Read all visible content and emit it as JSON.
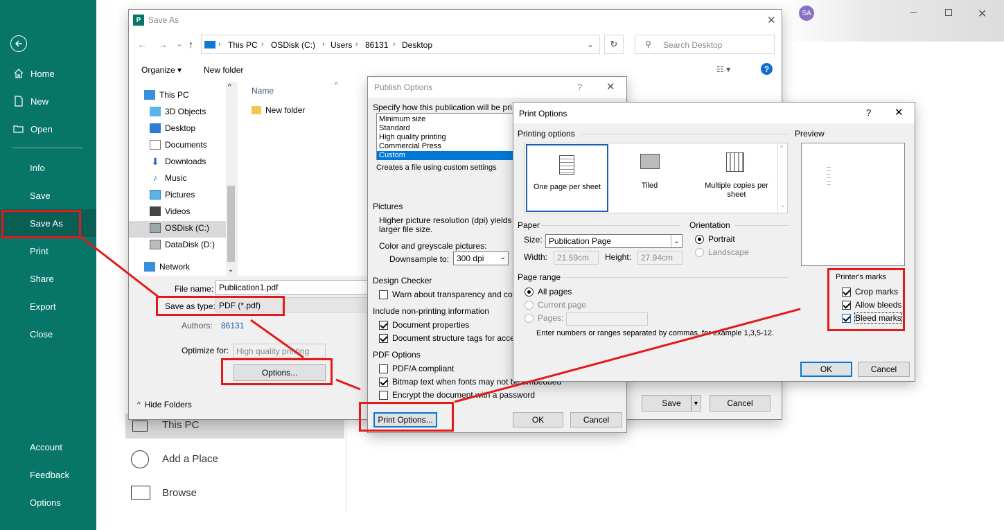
{
  "sidebar": {
    "items": [
      {
        "label": "Home"
      },
      {
        "label": "New"
      },
      {
        "label": "Open"
      },
      {
        "label": "Info"
      },
      {
        "label": "Save"
      },
      {
        "label": "Save As"
      },
      {
        "label": "Print"
      },
      {
        "label": "Share"
      },
      {
        "label": "Export"
      },
      {
        "label": "Close"
      },
      {
        "label": "Account"
      },
      {
        "label": "Feedback"
      },
      {
        "label": "Options"
      }
    ]
  },
  "header": {
    "avatar": "SA"
  },
  "places": {
    "this_pc": "This PC",
    "add_place": "Add a Place",
    "browse": "Browse"
  },
  "save_as_dialog": {
    "title": "Save As",
    "breadcrumb": [
      "This PC",
      "OSDisk (C:)",
      "Users",
      "86131",
      "Desktop"
    ],
    "search_placeholder": "Search Desktop",
    "organize": "Organize",
    "new_folder": "New folder",
    "tree": [
      "This PC",
      "3D Objects",
      "Desktop",
      "Documents",
      "Downloads",
      "Music",
      "Pictures",
      "Videos",
      "OSDisk (C:)",
      "DataDisk (D:)",
      "Network"
    ],
    "column_name": "Name",
    "files": [
      "New folder"
    ],
    "file_name_label": "File name:",
    "file_name": "Publication1.pdf",
    "save_type_label": "Save as type:",
    "save_type": "PDF (*.pdf)",
    "authors_label": "Authors:",
    "authors": "86131",
    "optimize_label": "Optimize for:",
    "optimize_value": "High quality printing",
    "options_button": "Options...",
    "hide_folders": "Hide Folders",
    "save_button": "Save",
    "cancel_button": "Cancel"
  },
  "publish_options": {
    "title": "Publish Options",
    "help": "?",
    "spec_label": "Specify how this publication will be pri",
    "list": [
      "Minimum size",
      "Standard",
      "High quality printing",
      "Commercial Press",
      "Custom"
    ],
    "selected_index": 4,
    "desc": "Creates a file using custom settings",
    "pictures_label": "Pictures",
    "pictures_text1": "Higher picture resolution (dpi) yields b",
    "pictures_text2": "larger file size.",
    "color_label": "Color and greyscale pictures:",
    "downsample_label": "Downsample to:",
    "downsample_value": "300 dpi",
    "design_checker": "Design Checker",
    "warn_transparency": "Warn about transparency and colo",
    "non_printing": "Include non-printing information",
    "doc_properties": "Document properties",
    "doc_structure": "Document structure tags for acces",
    "pdf_options": "PDF Options",
    "pdfa": "PDF/A compliant",
    "bitmap_text": "Bitmap text when fonts may not be embedded",
    "encrypt": "Encrypt the document with a password",
    "print_options_button": "Print Options...",
    "ok": "OK",
    "cancel": "Cancel"
  },
  "print_options": {
    "title": "Print Options",
    "help": "?",
    "printing_options_label": "Printing options",
    "option_one": "One page per sheet",
    "option_tiled": "Tiled",
    "option_multi": "Multiple copies per sheet",
    "preview_label": "Preview",
    "paper_label": "Paper",
    "size_label": "Size:",
    "size_value": "Publication Page",
    "width_label": "Width:",
    "width_value": "21.59cm",
    "height_label": "Height:",
    "height_value": "27.94cm",
    "orientation_label": "Orientation",
    "portrait": "Portrait",
    "landscape": "Landscape",
    "page_range_label": "Page range",
    "all_pages": "All pages",
    "current_page": "Current page",
    "pages": "Pages:",
    "pages_hint": "Enter numbers or ranges separated by commas, for example 1,3,5-12.",
    "printers_marks_label": "Printer's marks",
    "crop_marks": "Crop marks",
    "allow_bleeds": "Allow bleeds",
    "bleed_marks": "Bleed marks",
    "ok": "OK",
    "cancel": "Cancel"
  },
  "colors": {
    "sidebar": "#077568",
    "highlight": "#e41a1a",
    "selection": "#0078d7"
  }
}
